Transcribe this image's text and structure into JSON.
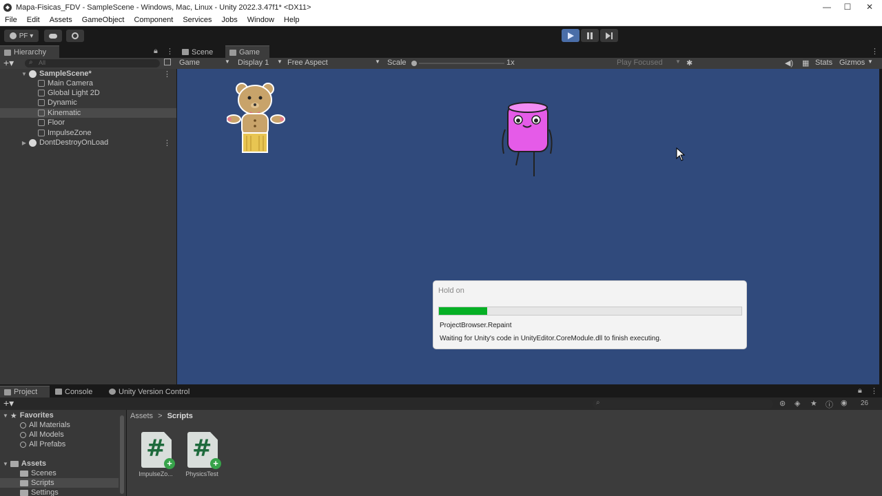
{
  "titlebar": {
    "title": "Mapa-Fisicas_FDV - SampleScene - Windows, Mac, Linux - Unity 2022.3.47f1* <DX11>",
    "minimize": "—",
    "maximize": "☐",
    "close": "✕"
  },
  "menu": [
    "File",
    "Edit",
    "Assets",
    "GameObject",
    "Component",
    "Services",
    "Jobs",
    "Window",
    "Help"
  ],
  "toolbar": {
    "account": "PF ▾",
    "cloud_icon": "cloud-icon",
    "settings_icon": "gear-icon"
  },
  "hierarchy": {
    "tab_label": "Hierarchy",
    "search_placeholder": "All",
    "scene": "SampleScene*",
    "items": [
      "Main Camera",
      "Global Light 2D",
      "Dynamic",
      "Kinematic",
      "Floor",
      "ImpulseZone"
    ],
    "selected": "Kinematic",
    "dont_destroy": "DontDestroyOnLoad"
  },
  "gameview": {
    "tabs": [
      "Scene",
      "Game"
    ],
    "active_tab": "Game",
    "mode": "Game",
    "display": "Display 1",
    "aspect": "Free Aspect",
    "scale_label": "Scale",
    "scale_value": "1x",
    "play_focused": "Play Focused",
    "stats": "Stats",
    "gizmos": "Gizmos",
    "background": "#304a7c"
  },
  "dialog": {
    "title": "Hold on",
    "progress": 0.16,
    "line1": "ProjectBrowser.Repaint",
    "line2": "Waiting for Unity's code in UnityEditor.CoreModule.dll to finish executing.",
    "accent": "#06b025"
  },
  "bottom_tabs": [
    "Project",
    "Console",
    "Unity Version Control"
  ],
  "project": {
    "favorites_label": "Favorites",
    "favorites": [
      "All Materials",
      "All Models",
      "All Prefabs"
    ],
    "assets_label": "Assets",
    "folders": [
      "Scenes",
      "Scripts",
      "Settings"
    ],
    "selected_folder": "Scripts",
    "breadcrumb_root": "Assets",
    "breadcrumb_sep": ">",
    "breadcrumb_current": "Scripts",
    "files": [
      "ImpulseZo...",
      "PhysicsTest"
    ],
    "hidden_count": "26"
  }
}
